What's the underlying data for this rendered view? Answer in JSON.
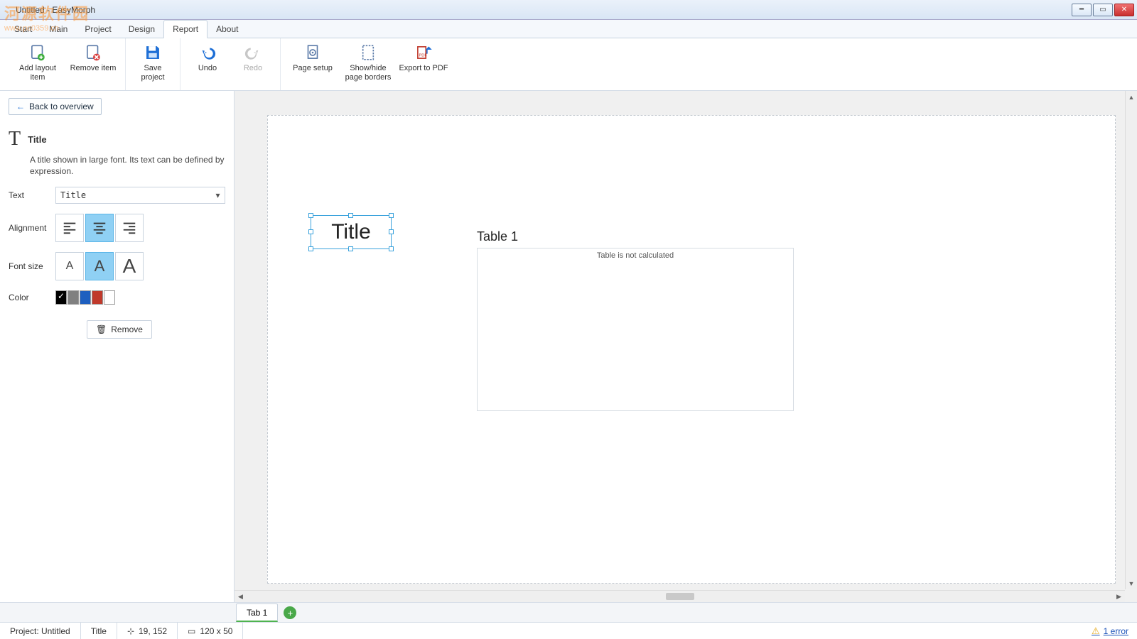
{
  "window": {
    "title": "Untitled - EasyMorph"
  },
  "watermark": {
    "main": "河源软件园",
    "sub": "www.pc0359.cn"
  },
  "tabs": {
    "items": [
      "Start",
      "Main",
      "Project",
      "Design",
      "Report",
      "About"
    ],
    "active": "Report"
  },
  "ribbon": {
    "add_layout_item": "Add layout\nitem",
    "remove_item": "Remove item",
    "save_project": "Save\nproject",
    "undo": "Undo",
    "redo": "Redo",
    "page_setup": "Page setup",
    "showhide": "Show/hide\npage borders",
    "export_pdf": "Export to PDF"
  },
  "side": {
    "back": "Back to overview",
    "title_label": "Title",
    "desc": "A title shown in large font. Its text can be defined by expression.",
    "text_label": "Text",
    "text_value": "Title",
    "alignment_label": "Alignment",
    "fontsize_label": "Font size",
    "color_label": "Color",
    "remove": "Remove",
    "colors": [
      "#000000",
      "#808080",
      "#1e5fbf",
      "#c0392b",
      "#ffffff"
    ]
  },
  "canvas": {
    "title_text": "Title",
    "table_label": "Table 1",
    "table_msg": "Table is not calculated"
  },
  "bottom": {
    "tab1": "Tab 1"
  },
  "status": {
    "project": "Project: Untitled",
    "selection": "Title",
    "pos": "19, 152",
    "size": "120 x 50",
    "errors": "1 error"
  }
}
